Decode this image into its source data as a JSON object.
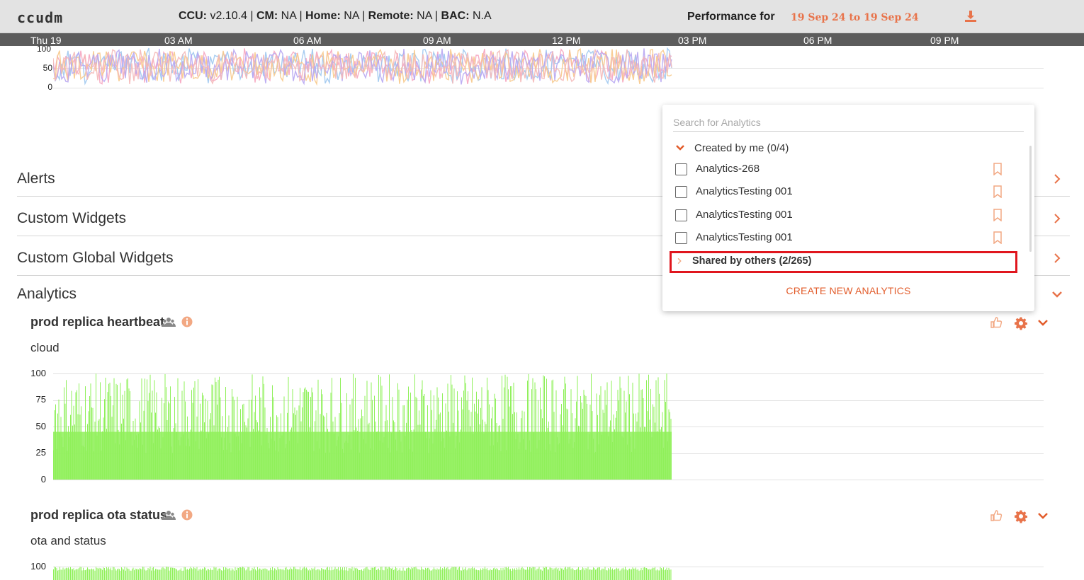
{
  "header": {
    "logo": "ccudm",
    "ccu_label": "CCU:",
    "ccu_value": " v2.10.4 | ",
    "cm_label": "CM:",
    "cm_value": " NA | ",
    "home_label": "Home:",
    "home_value": " NA | ",
    "remote_label": "Remote:",
    "remote_value": " NA | ",
    "bac_label": "BAC:",
    "bac_value": " N.A",
    "performance_label": "Performance for",
    "date_range": "19 Sep 24 to 19 Sep 24",
    "download_icon": "download-icon"
  },
  "time_axis": [
    "Thu 19",
    "03 AM",
    "06 AM",
    "09 AM",
    "12 PM",
    "03 PM",
    "06 PM",
    "09 PM"
  ],
  "top_chart": {
    "y_ticks": [
      "100",
      "50",
      "0"
    ],
    "colors": [
      "#f6a5c0",
      "#9ec8f0",
      "#f7c98b",
      "#b7a6f2",
      "#f4b8b8"
    ]
  },
  "sections": [
    {
      "title": "Alerts",
      "state": "collapsed"
    },
    {
      "title": "Custom Widgets",
      "state": "collapsed"
    },
    {
      "title": "Custom Global Widgets",
      "state": "collapsed"
    },
    {
      "title": "Analytics",
      "state": "expanded"
    }
  ],
  "widgets": [
    {
      "title": "prod replica heartbeat",
      "subtitle": "cloud",
      "chart_data": {
        "type": "bar",
        "y_ticks": [
          "100",
          "75",
          "50",
          "25",
          "0"
        ],
        "ylim": [
          0,
          100
        ],
        "color": "#8ff05a"
      }
    },
    {
      "title": "prod replica ota status",
      "subtitle": "ota and status",
      "chart_data": {
        "type": "bar",
        "y_ticks": [
          "100"
        ],
        "ylim": [
          0,
          100
        ],
        "color": "#8ff05a"
      }
    }
  ],
  "analytics_panel": {
    "search_placeholder": "Search for Analytics",
    "created_group": "Created by me (0/4)",
    "items": [
      "Analytics-268",
      "AnalyticsTesting 001",
      "AnalyticsTesting 001",
      "AnalyticsTesting 001"
    ],
    "shared_group": "Shared by others (2/265)",
    "create_button": "CREATE NEW ANALYTICS"
  },
  "accent_color": "#e8734a"
}
